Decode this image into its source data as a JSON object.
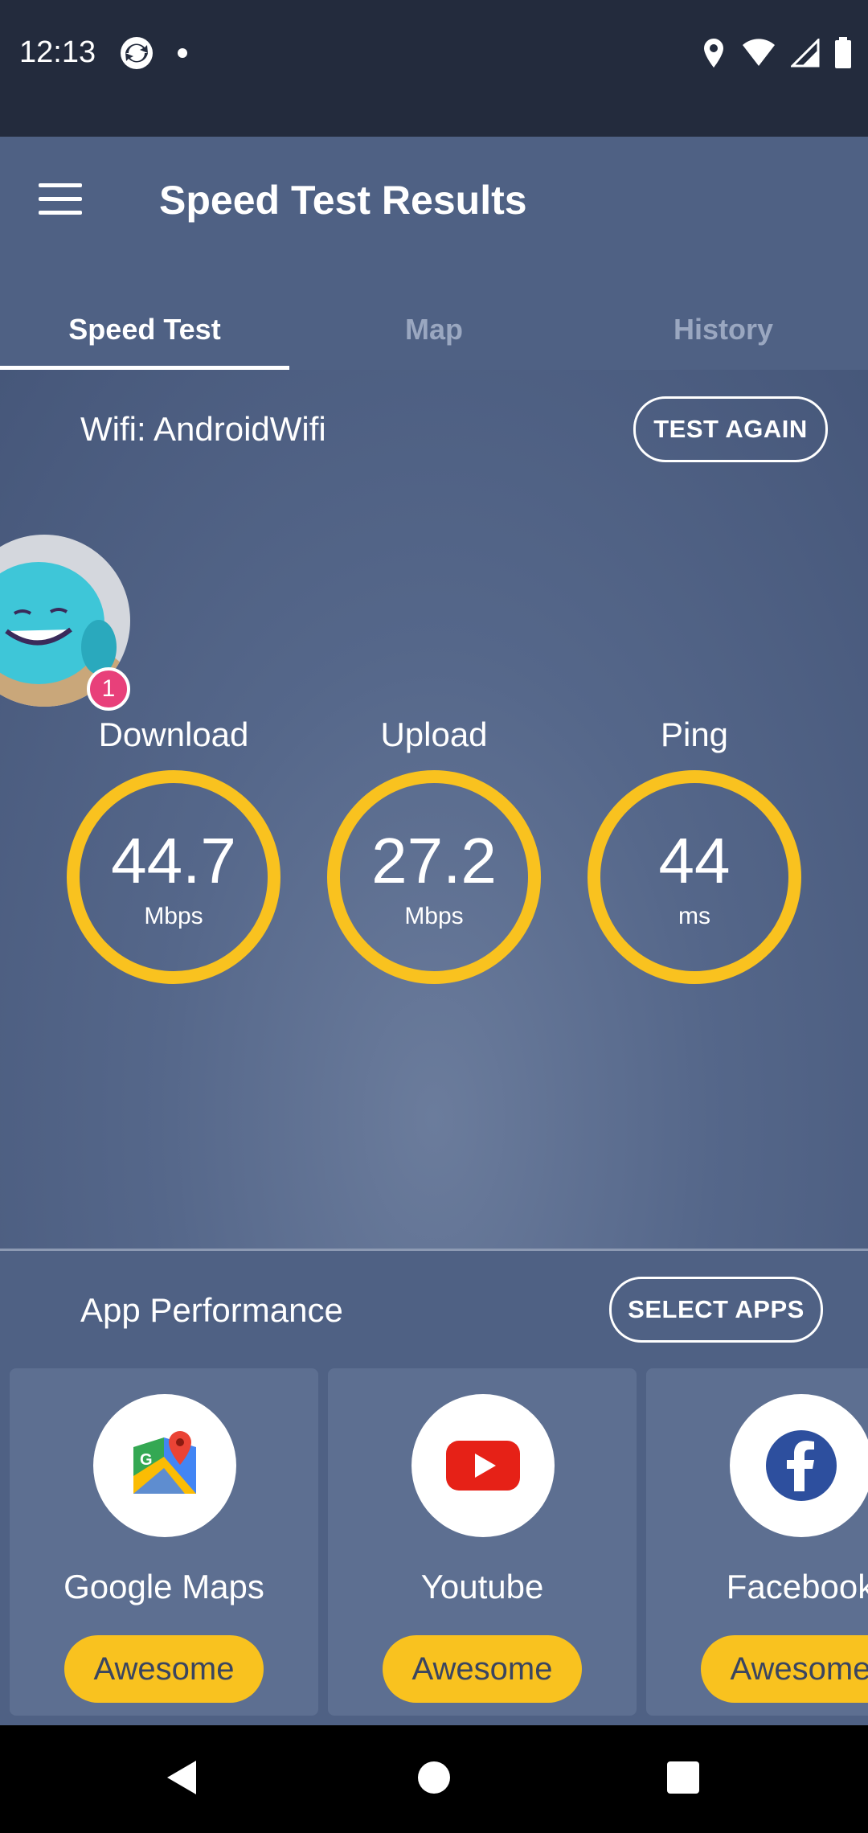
{
  "status_bar": {
    "time": "12:13"
  },
  "app_bar": {
    "title": "Speed Test Results"
  },
  "tabs": [
    {
      "label": "Speed Test",
      "active": true
    },
    {
      "label": "Map",
      "active": false
    },
    {
      "label": "History",
      "active": false
    }
  ],
  "connection": {
    "wifi_label": "Wifi: AndroidWifi",
    "test_again_label": "TEST AGAIN"
  },
  "notification_badge": "1",
  "metrics": [
    {
      "label": "Download",
      "value": "44.7",
      "unit": "Mbps"
    },
    {
      "label": "Upload",
      "value": "27.2",
      "unit": "Mbps"
    },
    {
      "label": "Ping",
      "value": "44",
      "unit": "ms"
    }
  ],
  "app_performance": {
    "title": "App Performance",
    "select_apps_label": "SELECT APPS",
    "apps": [
      {
        "name": "Google Maps",
        "rating": "Awesome",
        "icon": "google-maps-icon"
      },
      {
        "name": "Youtube",
        "rating": "Awesome",
        "icon": "youtube-icon"
      },
      {
        "name": "Facebook",
        "rating": "Awesome",
        "icon": "facebook-icon"
      }
    ]
  },
  "colors": {
    "accent": "#f9c21f",
    "app_bar": "#4f6184",
    "status_bar": "#232b3d",
    "badge": "#e8407a"
  }
}
